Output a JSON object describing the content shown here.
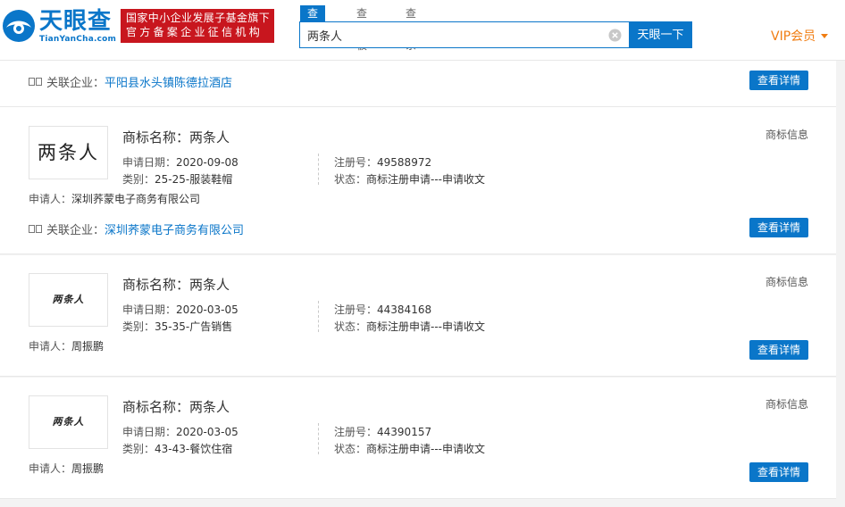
{
  "header": {
    "logo_cn": "天眼查",
    "logo_en": "TianYanCha.com",
    "badge_line1": "国家中小企业发展子基金旗下",
    "badge_line2": "官方备案企业征信机构",
    "search_tabs": [
      "查公司",
      "查老板",
      "查关系"
    ],
    "search_value": "两条人",
    "search_button": "天眼一下",
    "vip_label": "VIP会员",
    "colors": {
      "brand": "#0a76c9",
      "badge": "#c8161e",
      "vip": "#f07d12"
    }
  },
  "top_entry": {
    "assoc_label": "关联企业：",
    "assoc_company": "平阳县水头镇陈德拉酒店",
    "detail_button": "查看详情"
  },
  "trademarks": [
    {
      "image_text": "两条人",
      "name_label": "商标名称：",
      "name": "两条人",
      "type_tag": "商标信息",
      "date_label": "申请日期：",
      "date": "2020-09-08",
      "class_label": "类别：",
      "class": "25-25-服装鞋帽",
      "reg_label": "注册号：",
      "reg_no": "49588972",
      "status_label": "状态：",
      "status": "商标注册申请---申请收文",
      "applicant_label": "申请人：",
      "applicant": "深圳荞蒙电子商务有限公司",
      "assoc_label": "关联企业：",
      "assoc_company": "深圳荞蒙电子商务有限公司",
      "detail_button": "查看详情"
    },
    {
      "image_text": "两条人",
      "name_label": "商标名称：",
      "name": "两条人",
      "type_tag": "商标信息",
      "date_label": "申请日期：",
      "date": "2020-03-05",
      "class_label": "类别：",
      "class": "35-35-广告销售",
      "reg_label": "注册号：",
      "reg_no": "44384168",
      "status_label": "状态：",
      "status": "商标注册申请---申请收文",
      "applicant_label": "申请人：",
      "applicant": "周振鹏",
      "detail_button": "查看详情"
    },
    {
      "image_text": "两条人",
      "name_label": "商标名称：",
      "name": "两条人",
      "type_tag": "商标信息",
      "date_label": "申请日期：",
      "date": "2020-03-05",
      "class_label": "类别：",
      "class": "43-43-餐饮住宿",
      "reg_label": "注册号：",
      "reg_no": "44390157",
      "status_label": "状态：",
      "status": "商标注册申请---申请收文",
      "applicant_label": "申请人：",
      "applicant": "周振鹏",
      "detail_button": "查看详情"
    }
  ]
}
